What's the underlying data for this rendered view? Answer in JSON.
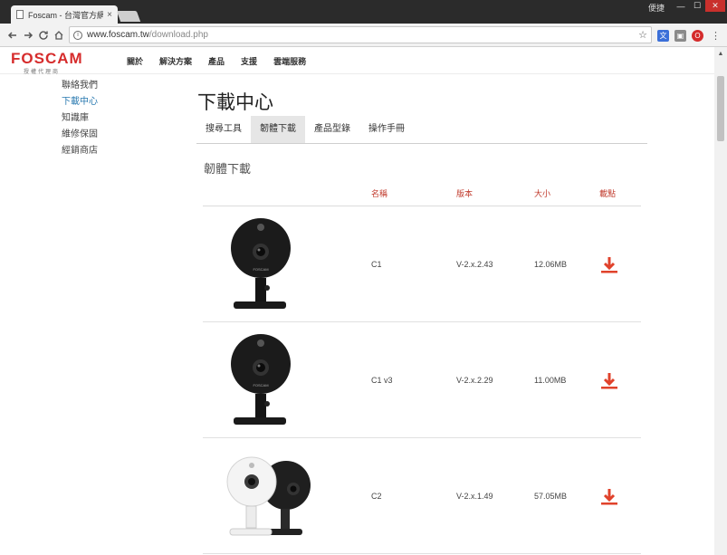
{
  "browser": {
    "tab_title": "Foscam - 台灣官方網站",
    "tab_close": "×",
    "profile": "便捷",
    "win_minimize": "—",
    "win_maximize": "☐",
    "win_close": "✕",
    "url_host": "www.foscam.tw",
    "url_path": "/download.php",
    "ext_icons": [
      "translate-icon",
      "pocket-icon",
      "opera-icon",
      "puzzle-icon"
    ]
  },
  "site": {
    "logo": "FOSCAM",
    "logo_sub": "授權代理商",
    "nav": [
      "關於",
      "解決方案",
      "產品",
      "支援",
      "雲端服務"
    ]
  },
  "sidebar": {
    "items": [
      {
        "label": "聯絡我們"
      },
      {
        "label": "下載中心"
      },
      {
        "label": "知識庫"
      },
      {
        "label": "維修保固"
      },
      {
        "label": "經銷商店"
      }
    ]
  },
  "main": {
    "title": "下載中心",
    "tabs": [
      {
        "label": "搜尋工具"
      },
      {
        "label": "韌體下載"
      },
      {
        "label": "產品型錄"
      },
      {
        "label": "操作手冊"
      }
    ],
    "section_title": "韌體下載",
    "table": {
      "headers": {
        "name": "名稱",
        "version": "版本",
        "size": "大小",
        "download": "載點"
      },
      "rows": [
        {
          "name": "C1",
          "version": "V-2.x.2.43",
          "size": "12.06MB"
        },
        {
          "name": "C1 v3",
          "version": "V-2.x.2.29",
          "size": "11.00MB"
        },
        {
          "name": "C2",
          "version": "V-2.x.1.49",
          "size": "57.05MB"
        }
      ]
    },
    "camera_brand": "FOSCAM"
  },
  "colors": {
    "brand_red": "#d62c2c",
    "active_link": "#2a7ab0",
    "download_icon": "#e0422b",
    "header_text": "#c0392b"
  }
}
